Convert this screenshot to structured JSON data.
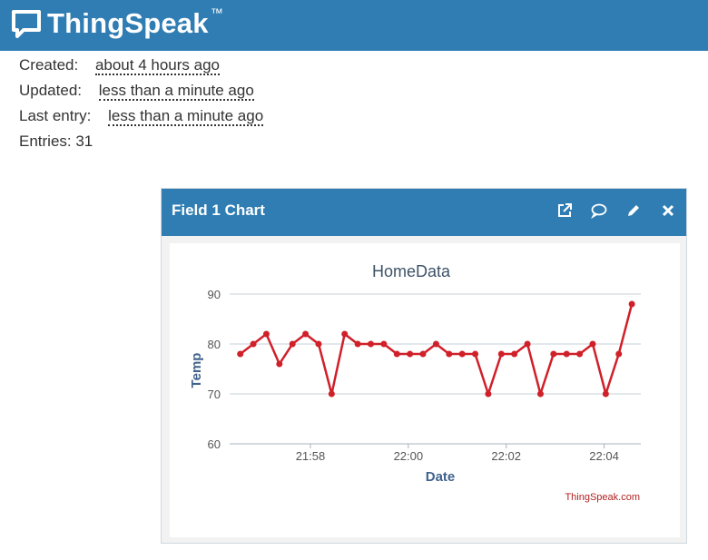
{
  "app": {
    "name": "ThingSpeak",
    "trademark": "™"
  },
  "channel_meta": {
    "created_label": "Created:",
    "created_value": "about 4 hours ago",
    "updated_label": "Updated:",
    "updated_value": "less than a minute ago",
    "last_entry_label": "Last entry:",
    "last_entry_value": "less than a minute ago",
    "entries_text": "Entries: 31"
  },
  "panel": {
    "title": "Field 1 Chart",
    "actions": [
      "external-link-icon",
      "comment-icon",
      "pencil-icon",
      "close-icon"
    ]
  },
  "colors": {
    "header": "#2f7db3",
    "series": "#d0202a",
    "axis_title": "#40628c",
    "credit": "#b22222"
  },
  "chart_data": {
    "type": "line",
    "title": "HomeData",
    "xlabel": "Date",
    "ylabel": "Temp",
    "ylim": [
      60,
      90
    ],
    "yticks": [
      60,
      70,
      80,
      90
    ],
    "xticks": [
      "21:58",
      "22:00",
      "22:02",
      "22:04"
    ],
    "grid": true,
    "credit": "ThingSpeak.com",
    "x": [
      "21:56:34",
      "21:56:50",
      "21:57:06",
      "21:57:22",
      "21:57:38",
      "21:57:54",
      "21:58:10",
      "21:58:26",
      "21:58:42",
      "21:58:58",
      "21:59:14",
      "21:59:30",
      "21:59:46",
      "22:00:02",
      "22:00:18",
      "22:00:34",
      "22:00:50",
      "22:01:06",
      "22:01:22",
      "22:01:38",
      "22:01:54",
      "22:02:10",
      "22:02:26",
      "22:02:42",
      "22:02:58",
      "22:03:14",
      "22:03:30",
      "22:03:46",
      "22:04:02",
      "22:04:18",
      "22:04:34"
    ],
    "series": [
      {
        "values": [
          78,
          80,
          82,
          76,
          80,
          82,
          80,
          70,
          82,
          80,
          80,
          80,
          78,
          78,
          78,
          80,
          78,
          78,
          78,
          70,
          78,
          78,
          80,
          70,
          78,
          78,
          78,
          80,
          70,
          78,
          88
        ]
      }
    ]
  }
}
